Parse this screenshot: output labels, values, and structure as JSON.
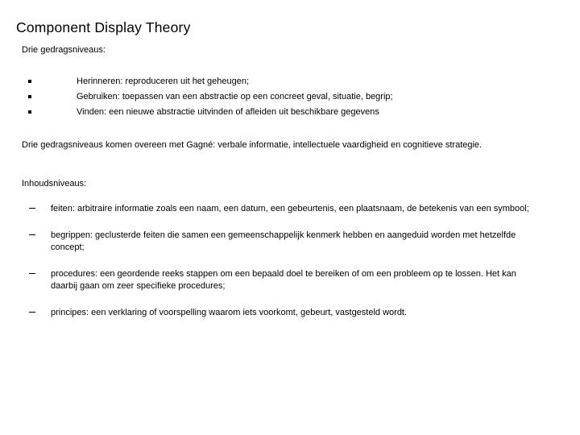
{
  "slide": {
    "title": "Component Display Theory",
    "lead_line": "Drie gedragsniveaus:",
    "behaviour_levels": [
      "Herinneren: reproduceren uit het geheugen;",
      "Gebruiken: toepassen van een abstractie op een concreet geval, situatie, begrip;",
      "Vinden: een nieuwe abstractie uitvinden of afleiden uit beschikbare gegevens"
    ],
    "paragraph": "Drie gedragsniveaus komen overeen met Gagné: verbale informatie, intellectuele vaardigheid en cognitieve strategie.",
    "section_label": "Inhoudsniveaus:",
    "content_levels": [
      "feiten: arbitraire informatie zoals een naam, een datum, een gebeurtenis, een plaatsnaam, de betekenis van een symbool;",
      "begrippen: geclusterde feiten die samen een gemeenschappelijk kenmerk hebben en aangeduid worden met hetzelfde concept;",
      "procedures: een geordende reeks stappen om een bepaald doel te bereiken of om een probleem op te lossen. Het kan daarbij gaan om zeer specifieke procedures;",
      "principes: een verklaring of voorspelling waarom iets voorkomt, gebeurt, vastgesteld wordt."
    ]
  }
}
